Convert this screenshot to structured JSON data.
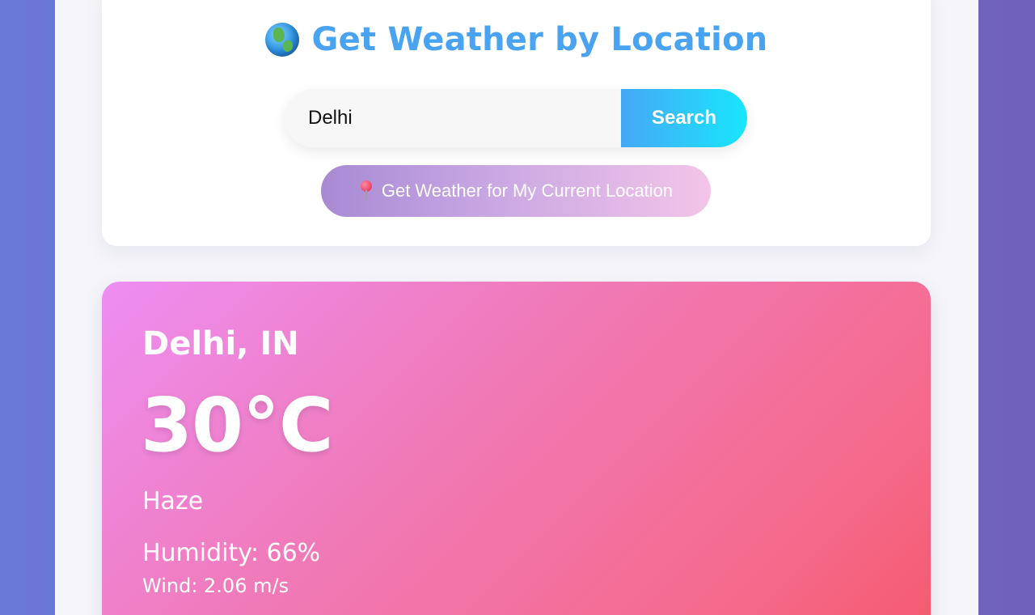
{
  "header": {
    "icon": "globe-icon",
    "title": "Get Weather by Location"
  },
  "search": {
    "value": "Delhi",
    "button_label": "Search"
  },
  "location": {
    "icon": "pin-icon",
    "button_label": "Get Weather for My Current Location"
  },
  "weather": {
    "city": "Delhi, IN",
    "temperature": "30°C",
    "condition": "Haze",
    "humidity": "Humidity: 66%",
    "wind": "Wind: 2.06 m/s"
  },
  "colors": {
    "title": "#4aa3f0",
    "search_button_start": "#45a8f5",
    "search_button_end": "#18e6fd",
    "weather_card_start": "#ee8ef2",
    "weather_card_end": "#f55a6e"
  }
}
